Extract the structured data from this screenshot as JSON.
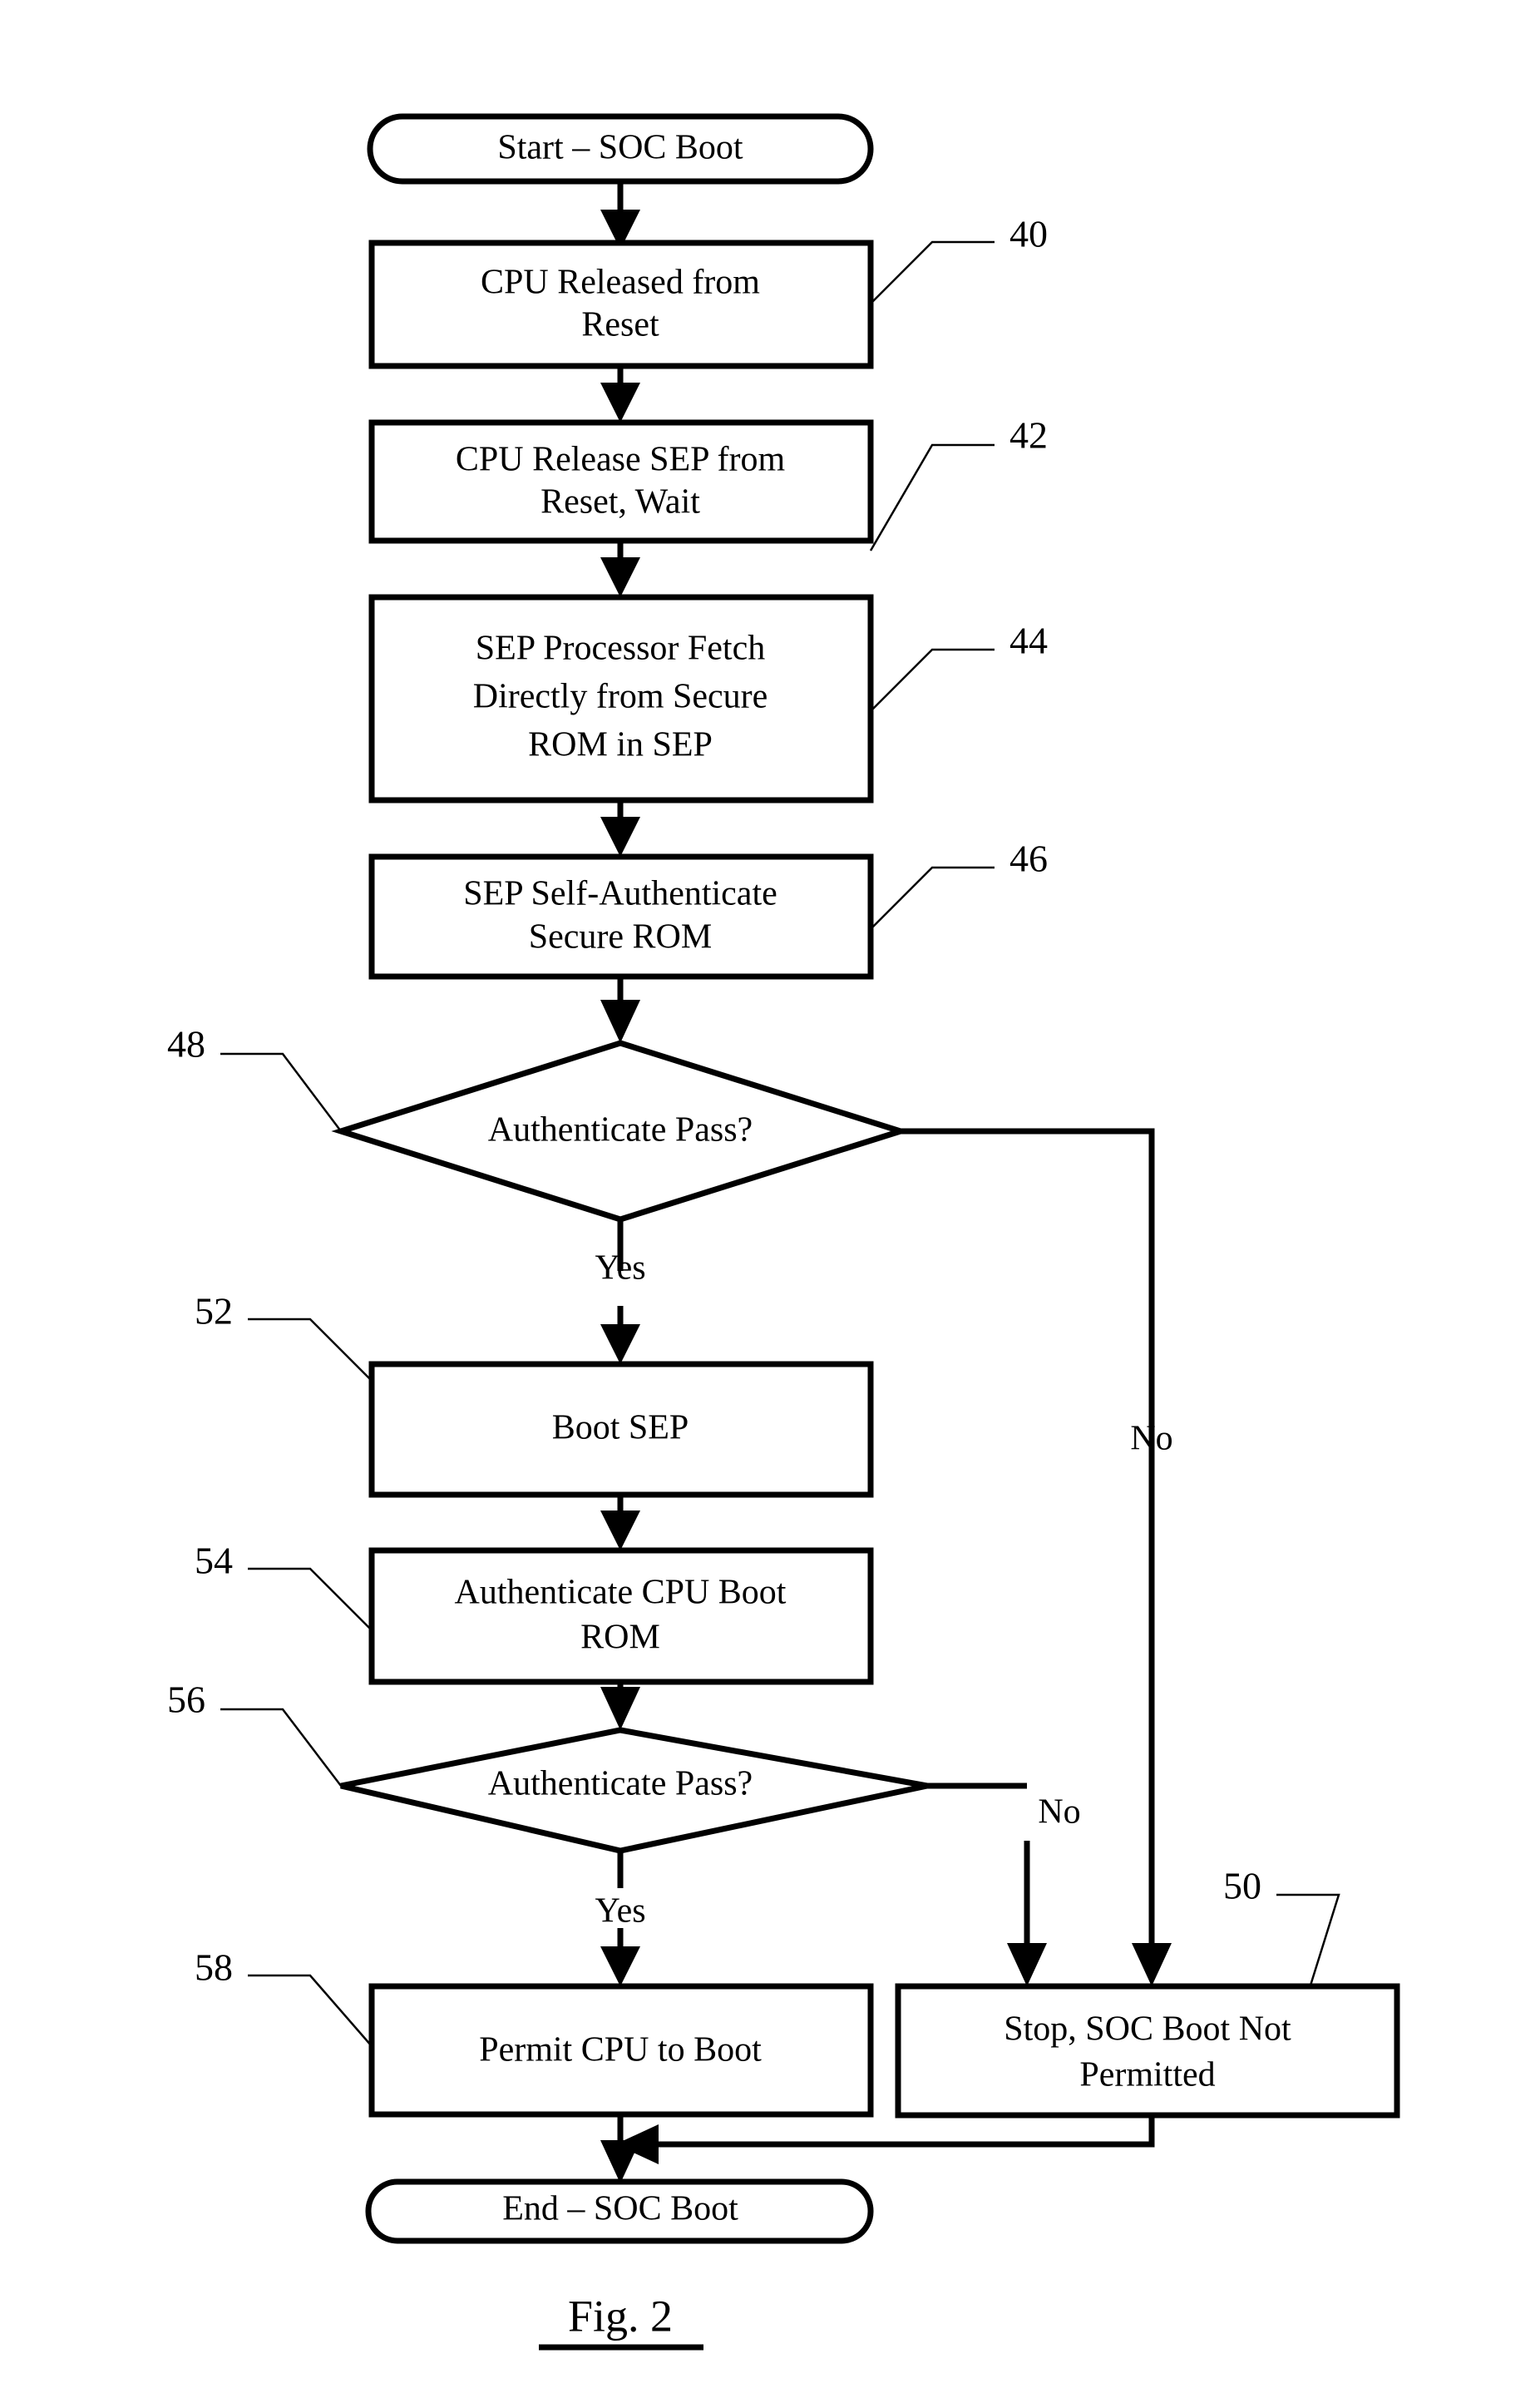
{
  "figure": {
    "caption": "Fig. 2",
    "caption_underlined": true,
    "title": "SOC Boot Flowchart",
    "ink_color": "#000000",
    "background_color": "#ffffff"
  },
  "nodes": [
    {
      "id": "start",
      "shape": "terminator",
      "lines": [
        "Start – SOC Boot"
      ],
      "ref": null
    },
    {
      "id": "cpu-released",
      "shape": "process",
      "lines": [
        "CPU Released from",
        "Reset"
      ],
      "ref": "40"
    },
    {
      "id": "cpu-release-sep",
      "shape": "process",
      "lines": [
        "CPU Release SEP from",
        "Reset, Wait"
      ],
      "ref": "42"
    },
    {
      "id": "sep-fetch",
      "shape": "process",
      "lines": [
        "SEP Processor Fetch",
        "Directly from Secure",
        "ROM in SEP"
      ],
      "ref": "44"
    },
    {
      "id": "sep-self-auth",
      "shape": "process",
      "lines": [
        "SEP Self-Authenticate",
        "Secure ROM"
      ],
      "ref": "46"
    },
    {
      "id": "auth-pass-1",
      "shape": "decision",
      "lines": [
        "Authenticate Pass?"
      ],
      "ref": "48"
    },
    {
      "id": "boot-sep",
      "shape": "process",
      "lines": [
        "Boot SEP"
      ],
      "ref": "52"
    },
    {
      "id": "auth-cpu-boot-rom",
      "shape": "process",
      "lines": [
        "Authenticate CPU Boot",
        "ROM"
      ],
      "ref": "54"
    },
    {
      "id": "auth-pass-2",
      "shape": "decision",
      "lines": [
        "Authenticate Pass?"
      ],
      "ref": "56"
    },
    {
      "id": "permit-cpu-boot",
      "shape": "process",
      "lines": [
        "Permit CPU to Boot"
      ],
      "ref": "58"
    },
    {
      "id": "stop-not-permitted",
      "shape": "process",
      "lines": [
        "Stop, SOC Boot Not",
        "Permitted"
      ],
      "ref": "50"
    },
    {
      "id": "end",
      "shape": "terminator",
      "lines": [
        "End – SOC Boot"
      ],
      "ref": null
    }
  ],
  "node_text": {
    "start": "Start – SOC Boot",
    "cpu_released_l1": "CPU Released from",
    "cpu_released_l2": "Reset",
    "cpu_release_sep_l1": "CPU Release SEP from",
    "cpu_release_sep_l2": "Reset, Wait",
    "sep_fetch_l1": "SEP Processor Fetch",
    "sep_fetch_l2": "Directly from Secure",
    "sep_fetch_l3": "ROM in SEP",
    "sep_self_auth_l1": "SEP Self-Authenticate",
    "sep_self_auth_l2": "Secure ROM",
    "auth_pass_1": "Authenticate Pass?",
    "boot_sep": "Boot SEP",
    "auth_cpu_boot_rom_l1": "Authenticate CPU Boot",
    "auth_cpu_boot_rom_l2": "ROM",
    "auth_pass_2": "Authenticate Pass?",
    "permit_cpu_boot": "Permit CPU to Boot",
    "stop_not_permitted_l1": "Stop, SOC Boot Not",
    "stop_not_permitted_l2": "Permitted",
    "end": "End – SOC Boot"
  },
  "branch_labels": {
    "yes_1": "Yes",
    "no_1": "No",
    "yes_2": "Yes",
    "no_2": "No"
  },
  "reference_numerals": {
    "n40": "40",
    "n42": "42",
    "n44": "44",
    "n46": "46",
    "n48": "48",
    "n50": "50",
    "n52": "52",
    "n54": "54",
    "n56": "56",
    "n58": "58"
  },
  "edges": [
    {
      "from": "start",
      "to": "cpu-released",
      "label": null
    },
    {
      "from": "cpu-released",
      "to": "cpu-release-sep",
      "label": null
    },
    {
      "from": "cpu-release-sep",
      "to": "sep-fetch",
      "label": null
    },
    {
      "from": "sep-fetch",
      "to": "sep-self-auth",
      "label": null
    },
    {
      "from": "sep-self-auth",
      "to": "auth-pass-1",
      "label": null
    },
    {
      "from": "auth-pass-1",
      "to": "boot-sep",
      "label": "Yes"
    },
    {
      "from": "auth-pass-1",
      "to": "stop-not-permitted",
      "label": "No"
    },
    {
      "from": "boot-sep",
      "to": "auth-cpu-boot-rom",
      "label": null
    },
    {
      "from": "auth-cpu-boot-rom",
      "to": "auth-pass-2",
      "label": null
    },
    {
      "from": "auth-pass-2",
      "to": "permit-cpu-boot",
      "label": "Yes"
    },
    {
      "from": "auth-pass-2",
      "to": "stop-not-permitted",
      "label": "No"
    },
    {
      "from": "permit-cpu-boot",
      "to": "end",
      "label": null
    },
    {
      "from": "stop-not-permitted",
      "to": "end",
      "label": null
    }
  ]
}
